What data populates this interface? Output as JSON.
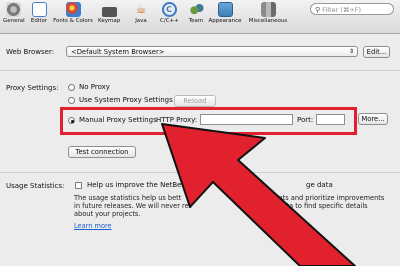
{
  "toolbar": {
    "tabs": [
      {
        "label": "General",
        "icon": "gear-switch-icon",
        "color": "#7a7a7a"
      },
      {
        "label": "Editor",
        "icon": "editor-icon",
        "color": "#4d7bc7"
      },
      {
        "label": "Fonts & Colors",
        "icon": "palette-icon",
        "color": "#d14b3a"
      },
      {
        "label": "Keymap",
        "icon": "keyboard-icon",
        "color": "#5a5a5a"
      },
      {
        "label": "Java",
        "icon": "java-cup-icon",
        "color": "#d86a1f"
      },
      {
        "label": "C/C++",
        "icon": "c-language-icon",
        "color": "#3b79c9"
      },
      {
        "label": "Team",
        "icon": "team-icon",
        "color": "#6c9a3d"
      },
      {
        "label": "Appearance",
        "icon": "appearance-icon",
        "color": "#3e7fb5"
      },
      {
        "label": "Miscellaneous",
        "icon": "misc-icon",
        "color": "#6a6a6a"
      }
    ],
    "search_placeholder": "Filter (⌘+F)"
  },
  "web_browser": {
    "label": "Web Browser:",
    "value": "<Default System Browser>",
    "edit_label": "Edit..."
  },
  "proxy": {
    "label": "Proxy Settings:",
    "options": [
      {
        "label": "No Proxy",
        "selected": false
      },
      {
        "label": "Use System Proxy Settings",
        "selected": false
      },
      {
        "label": "Manual Proxy Settings",
        "selected": true
      }
    ],
    "reload_label": "Reload",
    "http_proxy_label": "HTTP Proxy:",
    "http_proxy_value": "",
    "port_label": "Port:",
    "port_value": "",
    "more_label": "More...",
    "test_label": "Test connection"
  },
  "usage": {
    "label": "Usage Statistics:",
    "checkbox_label": "Help us improve the NetBea",
    "checkbox_tail": "ge data",
    "line1_a": "The usage statistics help us bett",
    "line1_b": "ments and prioritize improvements",
    "line2_a": "in future releases. We will never rev",
    "line2_b": "ed data to find specific details",
    "line3": "about your projects.",
    "learn_more": "Learn more"
  },
  "colors": {
    "highlight": "#e2212e",
    "arrow": "#e2212e"
  }
}
